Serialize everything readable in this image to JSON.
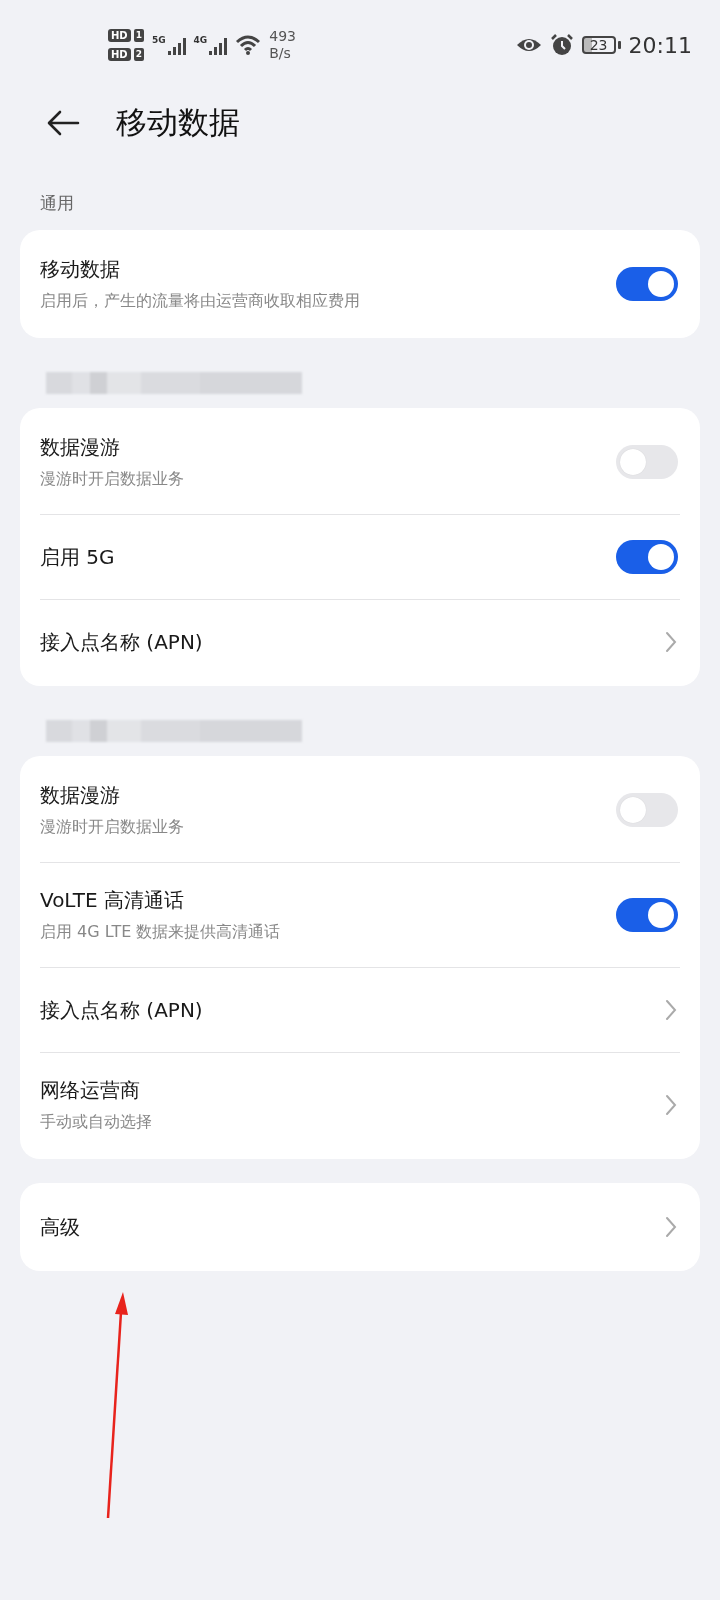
{
  "status_bar": {
    "sim_1": {
      "badge": "HD",
      "slot": "1"
    },
    "sim_2": {
      "badge": "HD",
      "slot": "2"
    },
    "network_1": "5G",
    "network_2": "4G",
    "speed_value": "493",
    "speed_unit": "B/s",
    "battery": "23",
    "time": "20:11"
  },
  "header": {
    "title": "移动数据"
  },
  "sections": [
    {
      "header": {
        "kind": "text",
        "text": "通用"
      },
      "items": [
        {
          "kind": "toggle",
          "title": "移动数据",
          "subtitle": "启用后，产生的流量将由运营商收取相应费用",
          "on": true
        }
      ]
    },
    {
      "header": {
        "kind": "redacted"
      },
      "items": [
        {
          "kind": "toggle",
          "title": "数据漫游",
          "subtitle": "漫游时开启数据业务",
          "on": false
        },
        {
          "kind": "toggle",
          "title": "启用 5G",
          "on": true
        },
        {
          "kind": "link",
          "title": "接入点名称 (APN)"
        }
      ]
    },
    {
      "header": {
        "kind": "redacted"
      },
      "items": [
        {
          "kind": "toggle",
          "title": "数据漫游",
          "subtitle": "漫游时开启数据业务",
          "on": false
        },
        {
          "kind": "toggle",
          "title": "VoLTE 高清通话",
          "subtitle": "启用 4G LTE 数据来提供高清通话",
          "on": true
        },
        {
          "kind": "link",
          "title": "接入点名称 (APN)"
        },
        {
          "kind": "link",
          "title": "网络运营商",
          "subtitle": "手动或自动选择"
        }
      ]
    },
    {
      "header": {
        "kind": "none"
      },
      "items": [
        {
          "kind": "link",
          "title": "高级"
        }
      ]
    }
  ],
  "annotation": {
    "kind": "arrow"
  }
}
